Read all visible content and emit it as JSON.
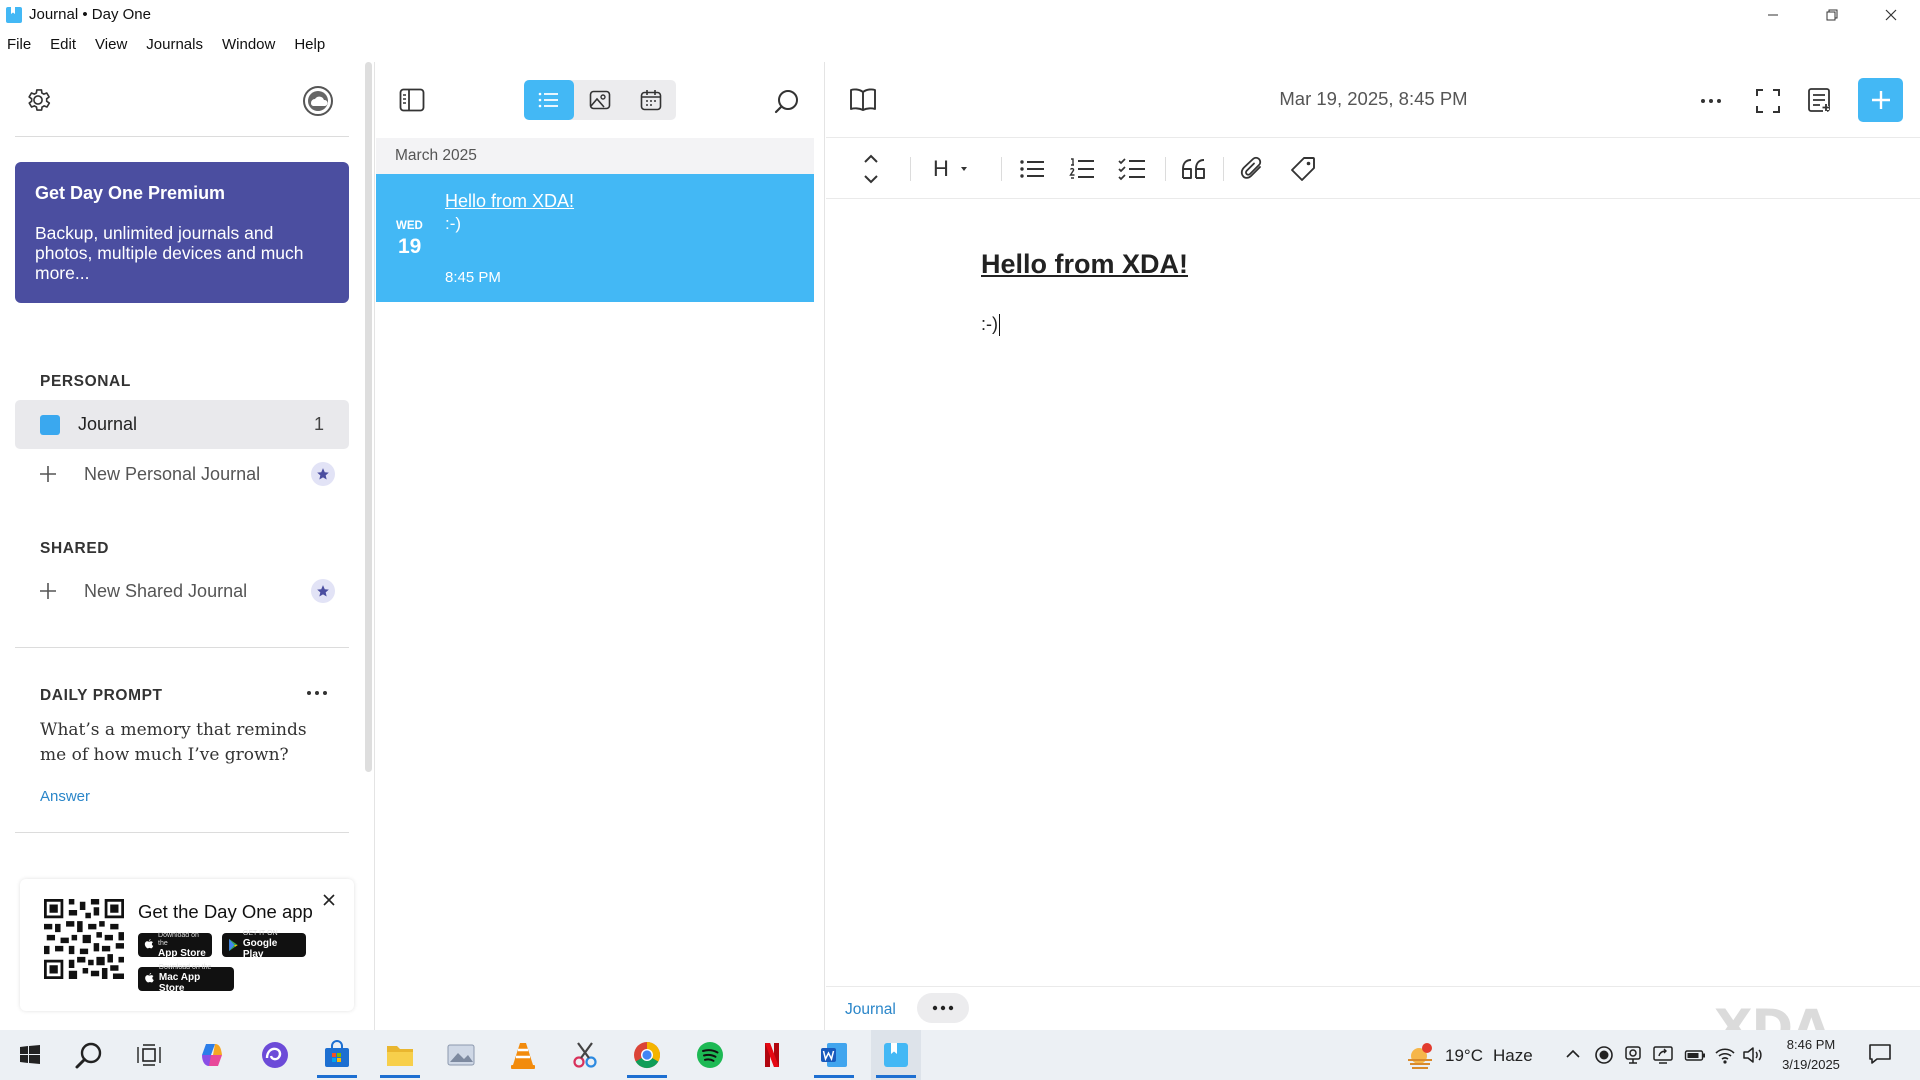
{
  "window": {
    "title": "Journal • Day One"
  },
  "menu": [
    "File",
    "Edit",
    "View",
    "Journals",
    "Window",
    "Help"
  ],
  "premium": {
    "title": "Get Day One Premium",
    "body": "Backup, unlimited journals and photos, multiple devices and much more..."
  },
  "sidebar": {
    "personal_heading": "PERSONAL",
    "journal_name": "Journal",
    "journal_count": "1",
    "new_personal": "New Personal Journal",
    "shared_heading": "SHARED",
    "new_shared": "New Shared Journal",
    "journal_color": "#3aa8ef"
  },
  "daily_prompt": {
    "heading": "DAILY PROMPT",
    "text": "What’s a memory that reminds me of how much I’ve grown?",
    "answer": "Answer"
  },
  "app_card": {
    "title": "Get the Day One app",
    "app_store_sub": "Download on the",
    "app_store": "App Store",
    "google_sub": "GET IT ON",
    "google": "Google Play",
    "mac_sub": "Download on the",
    "mac": "Mac App Store"
  },
  "entry_list": {
    "month": "March 2025",
    "entries": [
      {
        "dow": "WED",
        "day": "19",
        "title": "Hello from XDA!",
        "body": ":-)",
        "time": "8:45 PM"
      }
    ]
  },
  "editor": {
    "date": "Mar 19, 2025, 8:45 PM",
    "heading_button": "H",
    "doc_title": "Hello from XDA!",
    "doc_body": ":-)",
    "footer_journal": "Journal"
  },
  "taskbar": {
    "weather_temp": "19°C",
    "weather_desc": "Haze",
    "weather_alert": "1",
    "time": "8:46 PM",
    "date": "3/19/2025"
  },
  "watermark": "XDA",
  "colors": {
    "accent": "#43b8f5",
    "premium": "#4b4ea0",
    "link": "#2a86c9"
  }
}
